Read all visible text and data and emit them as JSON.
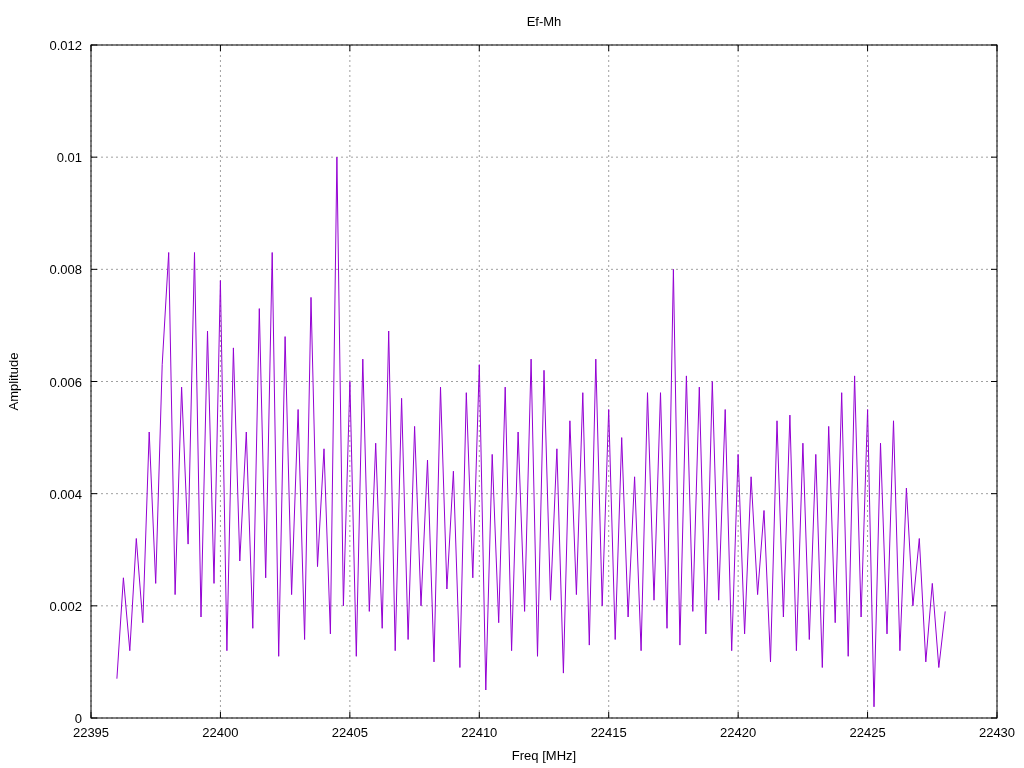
{
  "chart_data": {
    "type": "line",
    "title": "Ef-Mh",
    "xlabel": "Freq [MHz]",
    "ylabel": "Amplitude",
    "grid": true,
    "xlim": [
      22395,
      22430
    ],
    "ylim": [
      0,
      0.012
    ],
    "xticks": [
      22395,
      22400,
      22405,
      22410,
      22415,
      22420,
      22425,
      22430
    ],
    "yticks": [
      {
        "value": 0,
        "label": "0"
      },
      {
        "value": 0.002,
        "label": "0.002"
      },
      {
        "value": 0.004,
        "label": "0.004"
      },
      {
        "value": 0.006,
        "label": "0.006"
      },
      {
        "value": 0.008,
        "label": "0.008"
      },
      {
        "value": 0.01,
        "label": "0.01"
      },
      {
        "value": 0.012,
        "label": "0.012"
      }
    ],
    "x": [
      22396,
      22396.25,
      22396.5,
      22396.75,
      22397,
      22397.25,
      22397.5,
      22397.75,
      22398,
      22398.25,
      22398.5,
      22398.75,
      22399,
      22399.25,
      22399.5,
      22399.75,
      22400,
      22400.25,
      22400.5,
      22400.75,
      22401,
      22401.25,
      22401.5,
      22401.75,
      22402,
      22402.25,
      22402.5,
      22402.75,
      22403,
      22403.25,
      22403.5,
      22403.75,
      22404,
      22404.25,
      22404.5,
      22404.75,
      22405,
      22405.25,
      22405.5,
      22405.75,
      22406,
      22406.25,
      22406.5,
      22406.75,
      22407,
      22407.25,
      22407.5,
      22407.75,
      22408,
      22408.25,
      22408.5,
      22408.75,
      22409,
      22409.25,
      22409.5,
      22409.75,
      22410,
      22410.25,
      22410.5,
      22410.75,
      22411,
      22411.25,
      22411.5,
      22411.75,
      22412,
      22412.25,
      22412.5,
      22412.75,
      22413,
      22413.25,
      22413.5,
      22413.75,
      22414,
      22414.25,
      22414.5,
      22414.75,
      22415,
      22415.25,
      22415.5,
      22415.75,
      22416,
      22416.25,
      22416.5,
      22416.75,
      22417,
      22417.25,
      22417.5,
      22417.75,
      22418,
      22418.25,
      22418.5,
      22418.75,
      22419,
      22419.25,
      22419.5,
      22419.75,
      22420,
      22420.25,
      22420.5,
      22420.75,
      22421,
      22421.25,
      22421.5,
      22421.75,
      22422,
      22422.25,
      22422.5,
      22422.75,
      22423,
      22423.25,
      22423.5,
      22423.75,
      22424,
      22424.25,
      22424.5,
      22424.75,
      22425,
      22425.25,
      22425.5,
      22425.75,
      22426,
      22426.25,
      22426.5,
      22426.75,
      22427,
      22427.25,
      22427.5,
      22427.75,
      22428
    ],
    "series": [
      {
        "color": "#9400d3",
        "values": [
          0.0007,
          0.0025,
          0.0012,
          0.0032,
          0.0017,
          0.0051,
          0.0024,
          0.0063,
          0.0083,
          0.0022,
          0.0059,
          0.0031,
          0.0083,
          0.0018,
          0.0069,
          0.0024,
          0.0078,
          0.0012,
          0.0066,
          0.0028,
          0.0051,
          0.0016,
          0.0073,
          0.0025,
          0.0083,
          0.0011,
          0.0068,
          0.0022,
          0.0055,
          0.0014,
          0.0075,
          0.0027,
          0.0048,
          0.0015,
          0.01,
          0.002,
          0.006,
          0.0011,
          0.0064,
          0.0019,
          0.0049,
          0.0016,
          0.0069,
          0.0012,
          0.0057,
          0.0014,
          0.0052,
          0.002,
          0.0046,
          0.001,
          0.0059,
          0.0023,
          0.0044,
          0.0009,
          0.0058,
          0.0025,
          0.0063,
          0.0005,
          0.0047,
          0.0017,
          0.0059,
          0.0012,
          0.0051,
          0.0019,
          0.0064,
          0.0011,
          0.0062,
          0.0021,
          0.0048,
          0.0008,
          0.0053,
          0.0022,
          0.0058,
          0.0013,
          0.0064,
          0.002,
          0.0055,
          0.0014,
          0.005,
          0.0018,
          0.0043,
          0.0012,
          0.0058,
          0.0021,
          0.0058,
          0.0016,
          0.008,
          0.0013,
          0.0061,
          0.0019,
          0.0059,
          0.0015,
          0.006,
          0.0021,
          0.0055,
          0.0012,
          0.0047,
          0.0015,
          0.0043,
          0.0022,
          0.0037,
          0.001,
          0.0053,
          0.0018,
          0.0054,
          0.0012,
          0.0049,
          0.0014,
          0.0047,
          0.0009,
          0.0052,
          0.0017,
          0.0058,
          0.0011,
          0.0061,
          0.0018,
          0.0055,
          0.0002,
          0.0049,
          0.0015,
          0.0053,
          0.0012,
          0.0041,
          0.002,
          0.0032,
          0.001,
          0.0024,
          0.0009,
          0.0019
        ]
      }
    ]
  }
}
